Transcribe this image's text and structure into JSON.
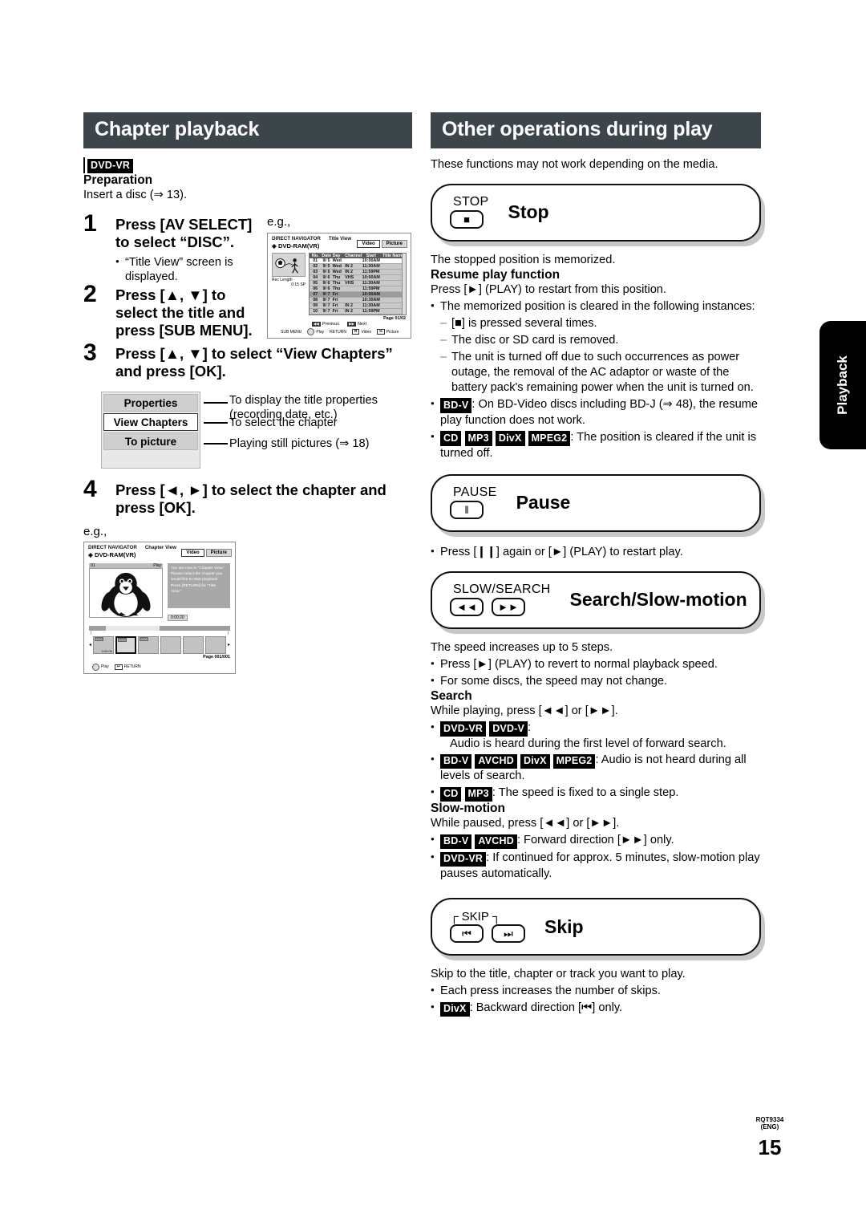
{
  "page": {
    "number": "15",
    "doc_code": "RQT9334",
    "language_code": "(ENG)",
    "side_tab": "Playback"
  },
  "left": {
    "section_title": "Chapter playback",
    "media_badge": "DVD-VR",
    "preparation_heading": "Preparation",
    "preparation_text": "Insert a disc (⇒ 13).",
    "eg_label": "e.g.,",
    "steps": [
      {
        "num": "1",
        "text": "Press [AV SELECT] to select “DISC”.",
        "note": "“Title View” screen is displayed."
      },
      {
        "num": "2",
        "text": "Press [▲, ▼] to select the title and press [SUB MENU].",
        "note": ""
      },
      {
        "num": "3",
        "text": "Press [▲, ▼] to select “View Chapters” and press [OK].",
        "note": ""
      },
      {
        "num": "4",
        "text": "Press [◄, ►] to select the chapter and press [OK].",
        "note": ""
      }
    ],
    "menu": {
      "items": [
        {
          "label": "Properties",
          "selected": false
        },
        {
          "label": "View Chapters",
          "selected": true
        },
        {
          "label": "To picture",
          "selected": false
        }
      ],
      "annotations": [
        "To display the title properties (recording date, etc.)",
        "To select the chapter",
        "Playing still pictures (⇒ 18)"
      ]
    },
    "title_view_shot": {
      "nav_label": "DIRECT NAVIGATOR",
      "view_label": "Title View",
      "disc_label": "DVD-RAM(VR)",
      "tabs": [
        "Video",
        "Picture"
      ],
      "active_tab": "Video",
      "rec_length_label": "Rec Length",
      "rec_length_value": "0:15 SP",
      "columns": [
        "No.",
        "Date",
        "Day",
        "Channel",
        "Start",
        "Title Name"
      ],
      "rows": [
        {
          "no": "01",
          "date": "9/ 5",
          "day": "Wed",
          "channel": "",
          "start": "10:00AM",
          "title": ""
        },
        {
          "no": "02",
          "date": "9/ 5",
          "day": "Wed",
          "channel": "IN 2",
          "start": "11:30AM",
          "title": ""
        },
        {
          "no": "03",
          "date": "9/ 5",
          "day": "Wed",
          "channel": "IN 2",
          "start": "11:59PM",
          "title": ""
        },
        {
          "no": "04",
          "date": "9/ 6",
          "day": "Thu",
          "channel": "VHS",
          "start": "10:00AM",
          "title": ""
        },
        {
          "no": "05",
          "date": "9/ 6",
          "day": "Thu",
          "channel": "VHS",
          "start": "11:30AM",
          "title": ""
        },
        {
          "no": "06",
          "date": "9/ 6",
          "day": "Thu",
          "channel": "",
          "start": "11:59PM",
          "title": ""
        },
        {
          "no": "07",
          "date": "9/ 7",
          "day": "Fri",
          "channel": "",
          "start": "10:00AM",
          "title": ""
        },
        {
          "no": "08",
          "date": "9/ 7",
          "day": "Fri",
          "channel": "",
          "start": "10:30AM",
          "title": ""
        },
        {
          "no": "09",
          "date": "9/ 7",
          "day": "Fri",
          "channel": "IN 2",
          "start": "11:30AM",
          "title": ""
        },
        {
          "no": "10",
          "date": "9/ 7",
          "day": "Fri",
          "channel": "IN 2",
          "start": "11:59PM",
          "title": ""
        }
      ],
      "page_indicator": "Page 01/02",
      "nav_previous": "Previous",
      "nav_next": "Next",
      "hints": [
        "SUB MENU",
        "RETURN",
        "Video",
        "Picture"
      ],
      "hint_play": "Play"
    },
    "chapter_view_shot": {
      "nav_label": "DIRECT NAVIGATOR",
      "view_label": "Chapter View",
      "disc_label": "DVD-RAM(VR)",
      "tabs": [
        "Video",
        "Picture"
      ],
      "active_tab": "Video",
      "chapter_no": "01",
      "play_label": "Play",
      "message": "You are now in \"Chapter View.\" Please select the chapter you would like to start playback. Press [RETURN] for \"Title View.\"",
      "time": "0:00:20",
      "thumbs": [
        {
          "no": "0001",
          "time": "0:00:00",
          "selected": false
        },
        {
          "no": "0002",
          "time": "0:00:20",
          "selected": true
        },
        {
          "no": "0003",
          "time": "0:00:45",
          "selected": false
        },
        {
          "no": "",
          "time": "",
          "selected": false
        },
        {
          "no": "",
          "time": "",
          "selected": false
        },
        {
          "no": "",
          "time": "",
          "selected": false
        }
      ],
      "page_indicator": "Page 001/001",
      "hint_play": "Play",
      "hint_return": "RETURN"
    }
  },
  "right": {
    "section_title": "Other operations during play",
    "intro": "These functions may not work depending on the media.",
    "operations": [
      {
        "key_label": "STOP",
        "keys": [
          "■"
        ],
        "title": "Stop",
        "body_intro": "The stopped position is memorized.",
        "sub_heading": "Resume play function",
        "sub_line": "Press [►] (PLAY) to restart from this position.",
        "bullets": [
          "The memorized position is cleared in the following instances:"
        ],
        "dashes": [
          "[■] is pressed several times.",
          "The disc or SD card is removed.",
          "The unit is turned off due to such occurrences as power outage, the removal of the AC adaptor or waste of the battery pack's remaining power when the unit is turned on."
        ],
        "chip_bullets": [
          {
            "chips": [
              "BD-V"
            ],
            "text": ": On BD-Video discs including BD-J (⇒ 48), the resume play function does not work."
          },
          {
            "chips": [
              "CD",
              "MP3",
              "DivX",
              "MPEG2"
            ],
            "text": ": The position is cleared if the unit is turned off."
          }
        ]
      },
      {
        "key_label": "PAUSE",
        "keys": [
          "‖"
        ],
        "title": "Pause",
        "bullets": [
          "Press [❙❙] again or [►] (PLAY) to restart play."
        ]
      },
      {
        "key_label": "SLOW/SEARCH",
        "keys": [
          "◄◄",
          "►►"
        ],
        "title": "Search/Slow-motion",
        "body_intro": "The speed increases up to 5 steps.",
        "bullets": [
          "Press [►] (PLAY) to revert to normal playback speed.",
          "For some discs, the speed may not change."
        ],
        "sections": [
          {
            "heading": "Search",
            "line": "While playing, press [◄◄] or [►►].",
            "chip_bullets": [
              {
                "chips": [
                  "DVD-VR",
                  "DVD-V"
                ],
                "text": ":",
                "continued": "Audio is heard during the first level of forward search."
              },
              {
                "chips": [
                  "BD-V",
                  "AVCHD",
                  "DivX",
                  "MPEG2"
                ],
                "text": ": Audio is not heard during all levels of search."
              },
              {
                "chips": [
                  "CD",
                  "MP3"
                ],
                "text": ": The speed is fixed to a single step."
              }
            ]
          },
          {
            "heading": "Slow-motion",
            "line": "While paused, press [◄◄] or [►►].",
            "chip_bullets": [
              {
                "chips": [
                  "BD-V",
                  "AVCHD"
                ],
                "text": ": Forward direction [►►] only."
              },
              {
                "chips": [
                  "DVD-VR"
                ],
                "text": ": If continued for approx. 5 minutes, slow-motion play pauses automatically."
              }
            ]
          }
        ]
      },
      {
        "key_label": "SKIP",
        "keys": [
          "⏮",
          "⏭"
        ],
        "title": "Skip",
        "body_intro": "Skip to the title, chapter or track you want to play.",
        "bullets": [
          "Each press increases the number of skips."
        ],
        "chip_bullets": [
          {
            "chips": [
              "DivX"
            ],
            "text": ": Backward direction [⏮] only."
          }
        ]
      }
    ]
  }
}
